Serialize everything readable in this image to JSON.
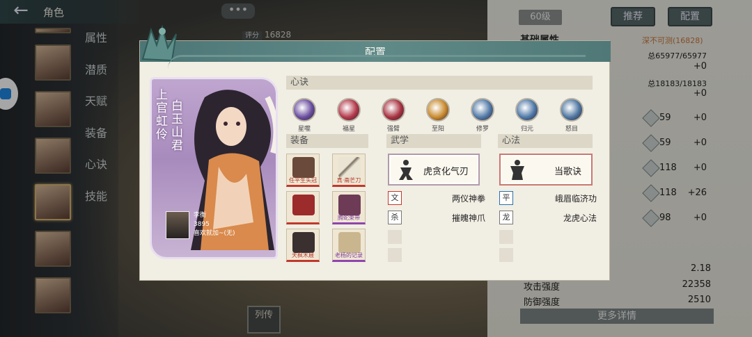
{
  "topbar": {
    "title": "角色",
    "back_icon": "arrow-left-icon"
  },
  "side_menu": [
    "属性",
    "潜质",
    "天赋",
    "装备",
    "心诀",
    "技能"
  ],
  "chat_icon": "•••",
  "score": {
    "label": "评分",
    "value": "16828"
  },
  "right_panel": {
    "level": "60级",
    "recommend": "推荐",
    "config": "配置",
    "basic_attr": "基础属性",
    "deep_label": "深不可测(16828)",
    "totals": [
      "总65977/65977",
      "总18183/18183"
    ],
    "plus_rows": [
      "+0",
      "+0",
      "+0",
      "+0",
      "+0",
      "+26",
      "+0"
    ],
    "stat_values": [
      "59",
      "59",
      "118",
      "118",
      "98"
    ],
    "value_218": "2.18",
    "attack_label": "攻击强度",
    "attack_value": "22358",
    "defense_label": "防御强度",
    "defense_value": "2510",
    "more": "更多详情"
  },
  "lie_button": "列传",
  "dialog": {
    "title": "配置",
    "card": {
      "name": "上官虹伶",
      "title": "白玉山君",
      "owner_name": "李衡",
      "owner_score": "3895",
      "owner_msg": "喜欢就加~(无)"
    },
    "xinjue_header": "心诀",
    "xinjue": [
      {
        "name": "星噬",
        "color": "#6b4fa0"
      },
      {
        "name": "福星",
        "color": "#b3394b"
      },
      {
        "name": "强臂",
        "color": "#a83240"
      },
      {
        "name": "至阳",
        "color": "#c98a2d"
      },
      {
        "name": "修罗",
        "color": "#5179a6"
      },
      {
        "name": "归元",
        "color": "#4f78a7"
      },
      {
        "name": "怒目",
        "color": "#4e76a0"
      }
    ],
    "equip_header": "装备",
    "equipment": [
      {
        "name": "任平生头冠",
        "rarity": "red"
      },
      {
        "name": "真·斋芒刀",
        "rarity": "red"
      },
      {
        "name": "",
        "rarity": "red"
      },
      {
        "name": "腾蛇束带",
        "rarity": "purple"
      },
      {
        "name": "天枫木屐",
        "rarity": "red"
      },
      {
        "name": "老杨的记录",
        "rarity": "purple"
      }
    ],
    "wuxue_header": "武学",
    "wuxue_main": "虎贪化气刃",
    "wuxue_subs": [
      "两仪神拳",
      "摧魄神爪"
    ],
    "xinfa_header": "心法",
    "xinfa_main": "当歌诀",
    "xinfa_subs": [
      "峨眉临济功",
      "龙虎心法"
    ]
  }
}
